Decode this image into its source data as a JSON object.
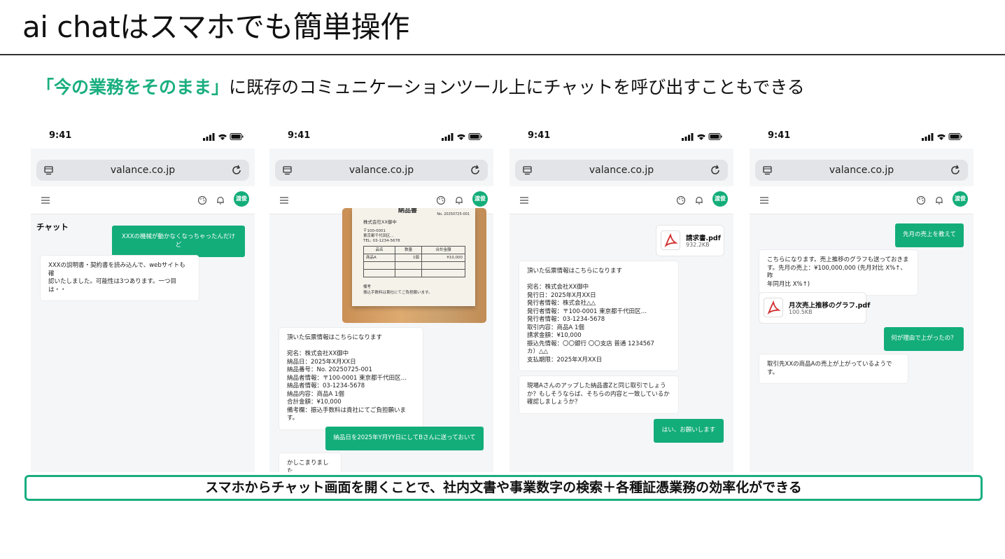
{
  "slide": {
    "title": "ai chatはスマホでも簡単操作",
    "subtitle_highlight": "「今の業務をそのまま」",
    "subtitle_rest": "に既存のコミュニケーションツール上にチャットを呼び出すこともできる",
    "footer": "スマホからチャット画面を開くことで、社内文書や事業数字の検索＋各種証憑業務の効率化ができる"
  },
  "colors": {
    "accent": "#1aae7f",
    "bubble_user": "#13ad7a",
    "screen_bg": "#f5f6f8"
  },
  "common": {
    "time": "9:41",
    "url": "valance.co.jp",
    "avatar": "渡俊"
  },
  "phone1": {
    "page_label": "チャット",
    "msg1": "XXXの機械が動かなくなっちゃったんだけど",
    "msg2": "XXXの説明書・契約書を読み込んで、webサイトも確\n認いたしました。可能性は3つあります。一つ目は・・"
  },
  "phone2": {
    "receipt": {
      "title": "納品書",
      "no": "No. 20250725-001",
      "to": "株式会社XX御中",
      "addr": "〒100-0001\n東京都千代田区…\nTEL: 03-1234-5678",
      "headers": [
        "品名",
        "数量",
        "合計金額"
      ],
      "row": [
        "商品A",
        "1個",
        "¥10,000"
      ],
      "note_h": "備考",
      "note": "振込手数料は貴社にてご負担願います。"
    },
    "msg_info": "頂いた伝票情報はこちらになります\n\n宛名：株式会社XX御中\n納品日：2025年X月XX日\n納品番号：No. 20250725-001\n納品者情報：〒100-0001 東京都千代田区…\n納品者情報：03-1234-5678\n納品内容：商品A  1個\n合計金額：¥10,000\n備考欄：振込手数料は貴社にてご負担願います。",
    "msg_user": "納品日を2025年Y月YY日にしてBさんに送っておいて",
    "msg_ack": "かしこまりました"
  },
  "phone3": {
    "file_name": "請求書.pdf",
    "file_size": "932.2KB",
    "msg_info": "頂いた伝票情報はこちらになります\n\n宛名：株式会社XX御中\n発行日：2025年X月XX日\n発行者情報：株式会社△△\n発行者情報：〒100-0001 東京都千代田区…\n発行者情報：03-1234-5678\n取引内容：商品A  1個\n請求金額：¥10,000\n振込先情報：〇〇銀行 〇〇支店  普通 1234567\nカ）△△\n支払期限：2025年X月XX日",
    "msg_suggest": "現場Aさんのアップした納品書Zと同じ取引でしょう\nか？もしそうならば、そちらの内容と一致しているか\n確認しましょうか？",
    "msg_user": "はい、お願いします"
  },
  "phone4": {
    "msg_user1": "先月の売上を教えて",
    "msg_bot1": "こちらになります。売上推移のグラフも送っておきま\nす。先月の売上：¥100,000,000 (先月対比 X%↑、昨\n年同月比  X%↑)",
    "file_name": "月次売上推移のグラフ.pdf",
    "file_size": "100.5KB",
    "msg_user2": "何が理由で上がったの？",
    "msg_bot2": "取引先XXの商品Aの売上が上がっているようです。"
  }
}
